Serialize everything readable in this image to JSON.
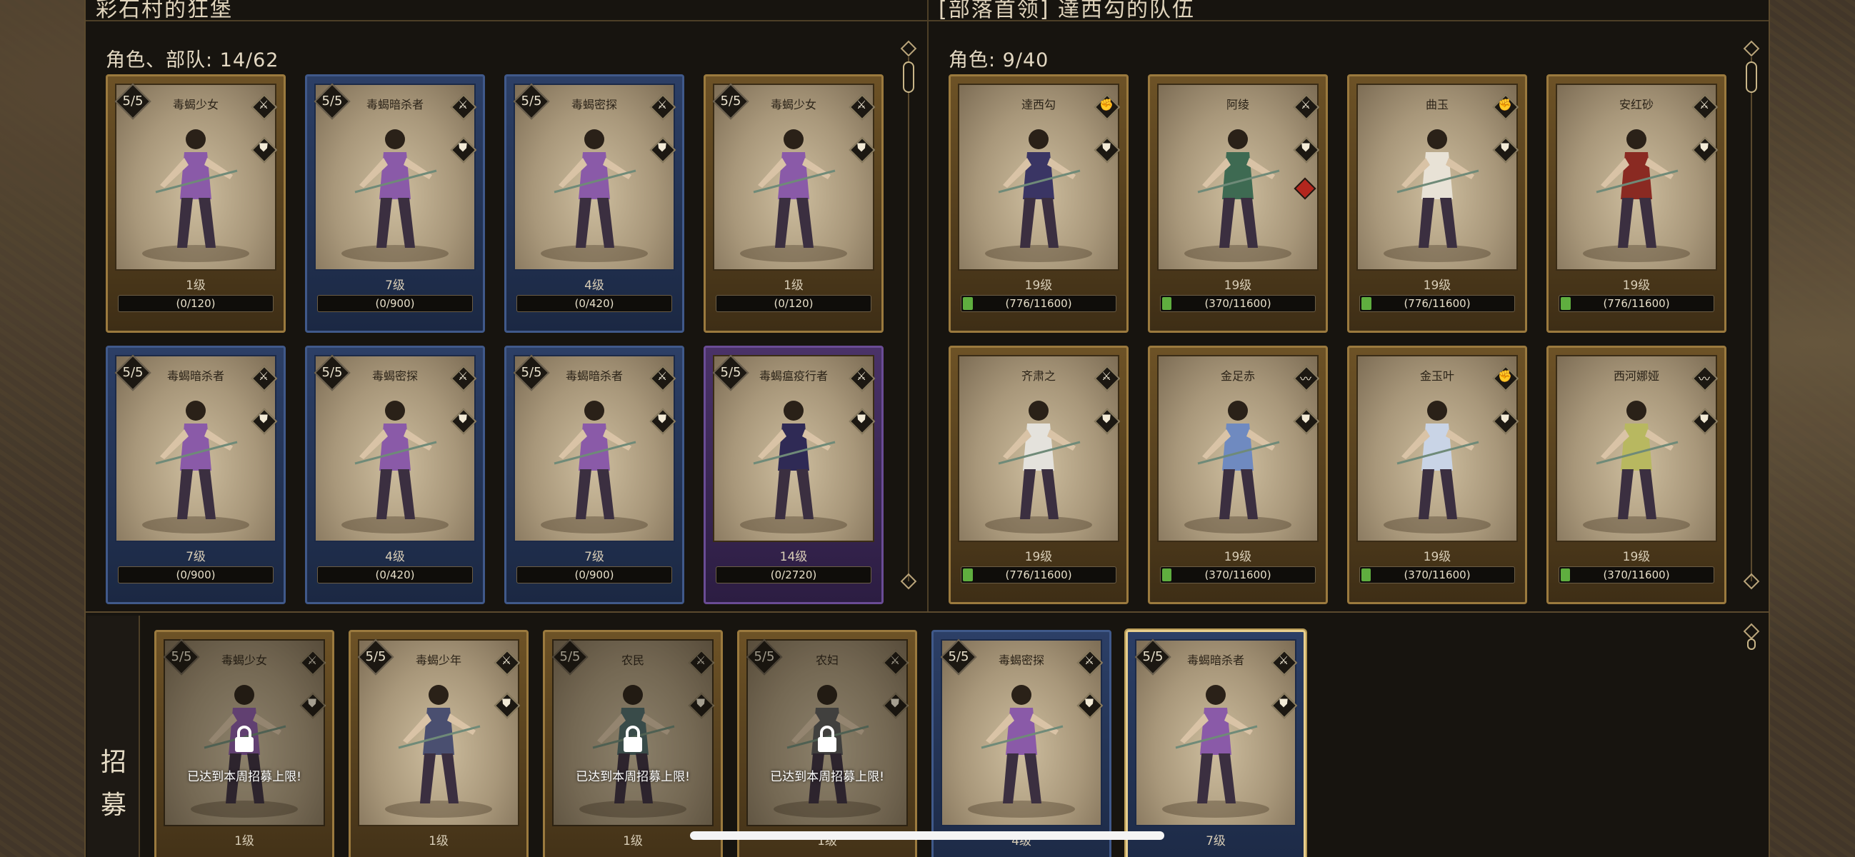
{
  "left_panel": {
    "title": "彩石村的狂堡",
    "count_label": "角色、部队: 14/62"
  },
  "right_panel": {
    "title": "[部落首领] 達西勾的队伍",
    "count_label": "角色: 9/40"
  },
  "recruit": {
    "label_1": "招",
    "label_2": "募",
    "limit_text": "已达到本周招募上限!"
  },
  "left_cards": [
    {
      "stars": "5/5",
      "name": "毒蝎少女",
      "level": "1级",
      "xp": "(0/120)",
      "frame": "gold",
      "type": "sword",
      "xp_fill": 0
    },
    {
      "stars": "5/5",
      "name": "毒蝎暗杀者",
      "level": "7级",
      "xp": "(0/900)",
      "frame": "blue",
      "type": "sword",
      "xp_fill": 0
    },
    {
      "stars": "5/5",
      "name": "毒蝎密探",
      "level": "4级",
      "xp": "(0/420)",
      "frame": "blue",
      "type": "sword",
      "xp_fill": 0
    },
    {
      "stars": "5/5",
      "name": "毒蝎少女",
      "level": "1级",
      "xp": "(0/120)",
      "frame": "gold",
      "type": "sword",
      "xp_fill": 0
    },
    {
      "stars": "5/5",
      "name": "毒蝎暗杀者",
      "level": "7级",
      "xp": "(0/900)",
      "frame": "blue",
      "type": "sword",
      "xp_fill": 0
    },
    {
      "stars": "5/5",
      "name": "毒蝎密探",
      "level": "4级",
      "xp": "(0/420)",
      "frame": "blue",
      "type": "sword",
      "xp_fill": 0
    },
    {
      "stars": "5/5",
      "name": "毒蝎暗杀者",
      "level": "7级",
      "xp": "(0/900)",
      "frame": "blue",
      "type": "sword",
      "xp_fill": 0
    },
    {
      "stars": "5/5",
      "name": "毒蝎瘟疫行者",
      "level": "14级",
      "xp": "(0/2720)",
      "frame": "purple",
      "type": "sword",
      "xp_fill": 0
    }
  ],
  "right_cards": [
    {
      "name": "達西勾",
      "level": "19级",
      "xp": "(776/11600)",
      "type": "fist",
      "xp_fill": 0.067
    },
    {
      "name": "阿绫",
      "level": "19级",
      "xp": "(370/11600)",
      "type": "sword",
      "xp_fill": 0.032
    },
    {
      "name": "曲玉",
      "level": "19级",
      "xp": "(776/11600)",
      "type": "fist",
      "xp_fill": 0.067
    },
    {
      "name": "安红砂",
      "level": "19级",
      "xp": "(776/11600)",
      "type": "sword",
      "xp_fill": 0.067
    },
    {
      "name": "齐肃之",
      "level": "19级",
      "xp": "(776/11600)",
      "type": "sword",
      "xp_fill": 0.067
    },
    {
      "name": "金足赤",
      "level": "19级",
      "xp": "(370/11600)",
      "type": "whip",
      "xp_fill": 0.032
    },
    {
      "name": "金玉叶",
      "level": "19级",
      "xp": "(370/11600)",
      "type": "fist",
      "xp_fill": 0.032
    },
    {
      "name": "西河娜娅",
      "level": "19级",
      "xp": "(370/11600)",
      "type": "whip",
      "xp_fill": 0.032
    }
  ],
  "recruit_cards": [
    {
      "stars": "5/5",
      "name": "毒蝎少女",
      "level": "1级",
      "locked": true,
      "frame": "gold",
      "type": "sword"
    },
    {
      "stars": "5/5",
      "name": "毒蝎少年",
      "level": "1级",
      "locked": false,
      "frame": "gold",
      "type": "sword"
    },
    {
      "stars": "5/5",
      "name": "农民",
      "level": "1级",
      "locked": true,
      "frame": "gold",
      "type": "sword"
    },
    {
      "stars": "5/5",
      "name": "农妇",
      "level": "1级",
      "locked": true,
      "frame": "gold",
      "type": "sword"
    },
    {
      "stars": "5/5",
      "name": "毒蝎密探",
      "level": "4级",
      "locked": false,
      "frame": "blue",
      "type": "sword"
    },
    {
      "stars": "5/5",
      "name": "毒蝎暗杀者",
      "level": "7级",
      "locked": false,
      "frame": "blue",
      "type": "sword",
      "selected": true
    }
  ],
  "icons": {
    "sword": "sword-icon",
    "shield": "shield-icon",
    "fist": "fist-icon",
    "whip": "whip-icon",
    "lock": "lock-icon"
  },
  "colors": {
    "xp_fill": "#5fae3f",
    "gold_frame": "#9b7a3e",
    "blue_frame": "#40598a",
    "purple_frame": "#6a4c95"
  }
}
